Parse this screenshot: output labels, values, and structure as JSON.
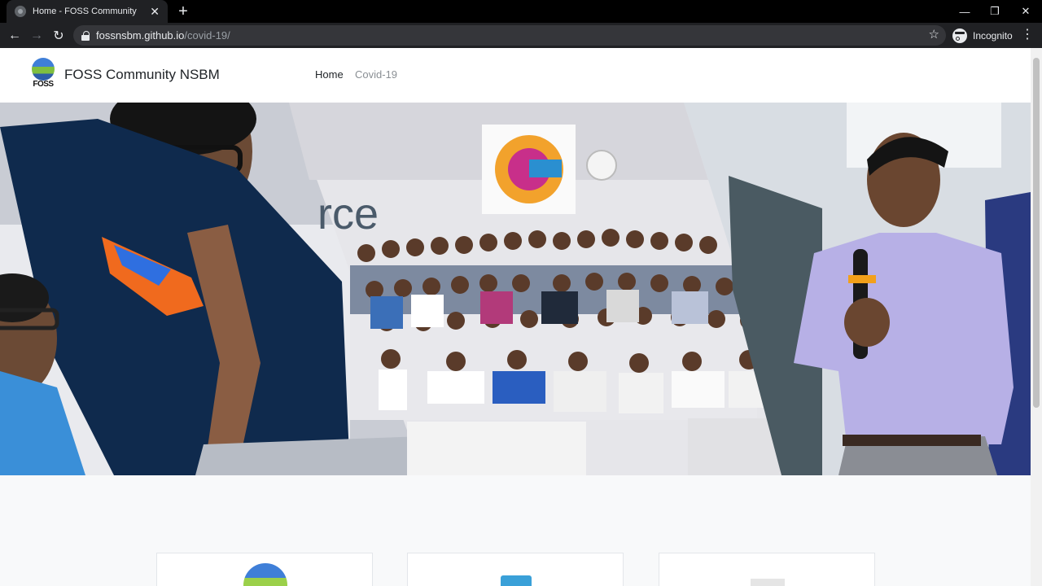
{
  "browser": {
    "tab_title": "Home - FOSS Community",
    "tab_close": "✕",
    "new_tab": "+",
    "url_host": "fossnsbm.github.io",
    "url_path": "/covid-19/",
    "incognito_label": "Incognito",
    "menu": "⋮",
    "bookmark": "☆",
    "back": "←",
    "forward": "→",
    "reload": "↻",
    "minimize": "—",
    "maximize": "❐",
    "close": "✕"
  },
  "site": {
    "logo_text": "FOSS",
    "brand": "FOSS Community NSBM",
    "nav": [
      {
        "label": "Home",
        "active": true
      },
      {
        "label": "Covid-19",
        "active": false
      }
    ]
  },
  "hero": {
    "wall_text": "rce"
  },
  "colors": {
    "brand_blue": "#3f7fd8",
    "brand_green": "#7fbf3f",
    "nav_active": "#212529",
    "nav_muted": "#8a8f94"
  },
  "icons": [
    "lock-icon",
    "star-icon",
    "incognito-icon",
    "kebab-menu-icon",
    "back-icon",
    "forward-icon",
    "reload-icon",
    "favicon-icon"
  ]
}
